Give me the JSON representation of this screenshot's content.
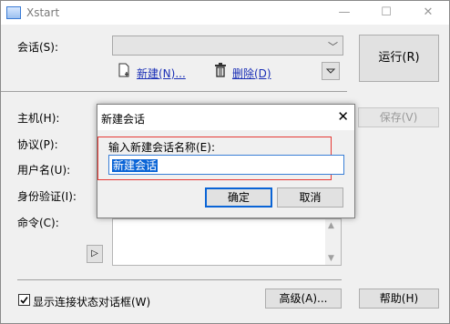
{
  "window": {
    "title": "Xstart",
    "controls": {
      "minimize": "—",
      "maximize": "☐",
      "close": "✕"
    }
  },
  "session": {
    "label": "会话(S):",
    "value": "",
    "new_link": "新建(N)...",
    "delete_link": "删除(D)"
  },
  "buttons": {
    "run": "运行(R)",
    "save": "保存(V)",
    "advanced": "高级(A)...",
    "help": "帮助(H)"
  },
  "labels": {
    "host": "主机(H):",
    "protocol": "协议(P):",
    "username": "用户名(U):",
    "auth": "身份验证(I):",
    "command": "命令(C):"
  },
  "command": {
    "value": "",
    "expand_glyph": "▷"
  },
  "checkbox": {
    "label": "显示连接状态对话框(W)",
    "checked": true
  },
  "dialog": {
    "title": "新建会话",
    "close": "✕",
    "field_label": "输入新建会话名称(E):",
    "field_value": "新建会话",
    "ok": "确定",
    "cancel": "取消"
  },
  "icons": {
    "new": "new-document-icon",
    "delete": "trash-icon",
    "dropdown": "chevron-down-icon"
  },
  "colors": {
    "highlight": "#e53935",
    "selection": "#0a64d6",
    "link": "#1a2fb6"
  }
}
